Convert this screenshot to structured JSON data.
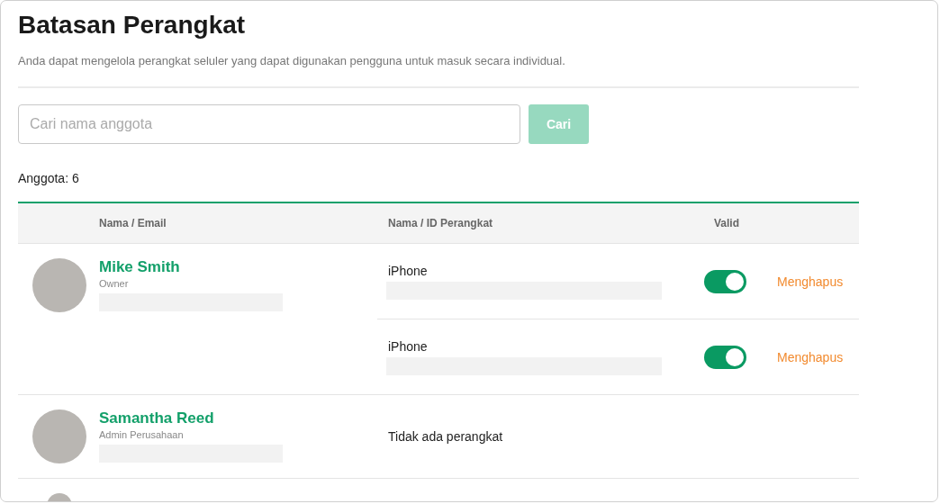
{
  "title": "Batasan Perangkat",
  "description": "Anda dapat mengelola perangkat seluler yang dapat digunakan pengguna untuk masuk secara individual.",
  "search": {
    "placeholder": "Cari nama anggota",
    "button": "Cari",
    "button_disabled": true
  },
  "member_count": "Anggota: 6",
  "table": {
    "columns": [
      "Nama / Email",
      "Nama / ID Perangkat",
      "Valid"
    ],
    "rows": [
      {
        "name": "Mike Smith",
        "role": "Owner",
        "devices": [
          {
            "name": "iPhone",
            "on": true,
            "action": "Menghapus"
          },
          {
            "name": "iPhone",
            "on": true,
            "action": "Menghapus"
          }
        ]
      },
      {
        "name": "Samantha Reed",
        "role": "Admin Perusahaan",
        "no_devices_text": "Tidak ada perangkat"
      },
      {
        "partial": true
      }
    ]
  }
}
